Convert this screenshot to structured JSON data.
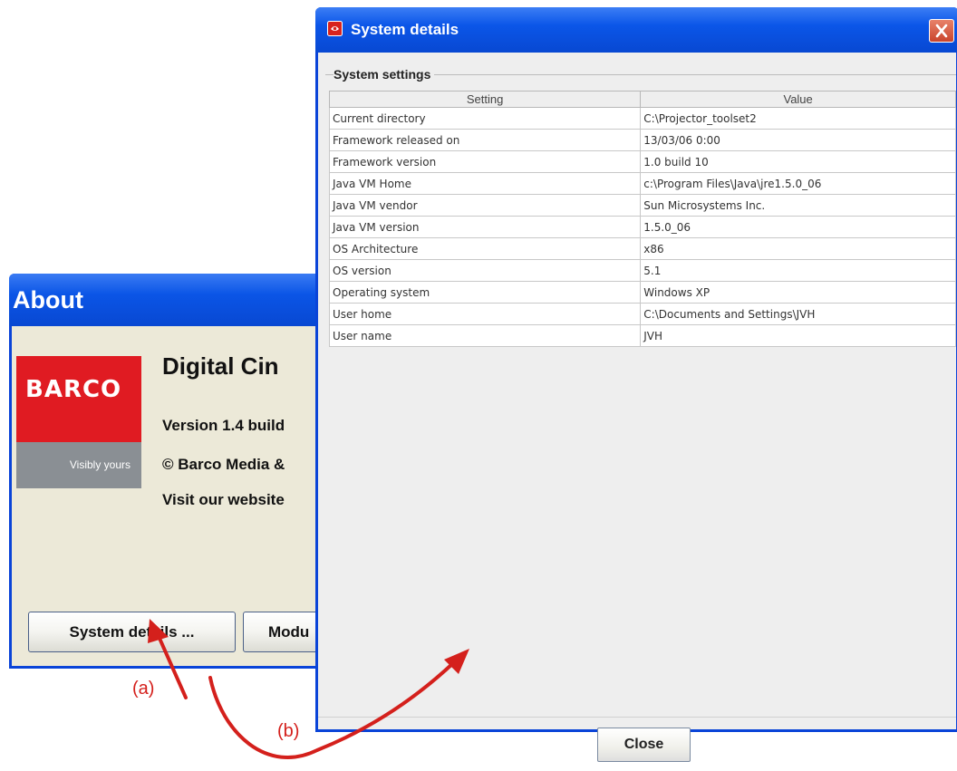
{
  "about_window": {
    "title": "About",
    "logo": {
      "brand": "BARCO",
      "tagline": "Visibly yours"
    },
    "heading": "Digital Cin",
    "version": "Version 1.4 build",
    "copyright": "© Barco Media &",
    "website": "Visit our website",
    "system_details_button": "System details ...",
    "modules_button": "Modu"
  },
  "system_details_window": {
    "title": "System details",
    "group_title": "System settings",
    "columns": [
      "Setting",
      "Value"
    ],
    "rows": [
      {
        "setting": "Current directory",
        "value": "C:\\Projector_toolset2"
      },
      {
        "setting": "Framework released on",
        "value": "13/03/06 0:00"
      },
      {
        "setting": "Framework version",
        "value": "1.0 build 10"
      },
      {
        "setting": "Java VM Home",
        "value": "c:\\Program Files\\Java\\jre1.5.0_06"
      },
      {
        "setting": "Java VM vendor",
        "value": "Sun Microsystems Inc."
      },
      {
        "setting": "Java VM version",
        "value": "1.5.0_06"
      },
      {
        "setting": "OS Architecture",
        "value": "x86"
      },
      {
        "setting": "OS version",
        "value": "5.1"
      },
      {
        "setting": "Operating system",
        "value": "Windows XP"
      },
      {
        "setting": "User home",
        "value": "C:\\Documents and Settings\\JVH"
      },
      {
        "setting": "User name",
        "value": "JVH"
      }
    ],
    "close_button": "Close"
  },
  "annotations": {
    "a": "(a)",
    "b": "(b)",
    "arrow_color": "#d4201c"
  },
  "colors": {
    "titlebar_blue": "#0a44d8",
    "barco_red": "#e01b22",
    "dialog_bg": "#eeeeee"
  }
}
